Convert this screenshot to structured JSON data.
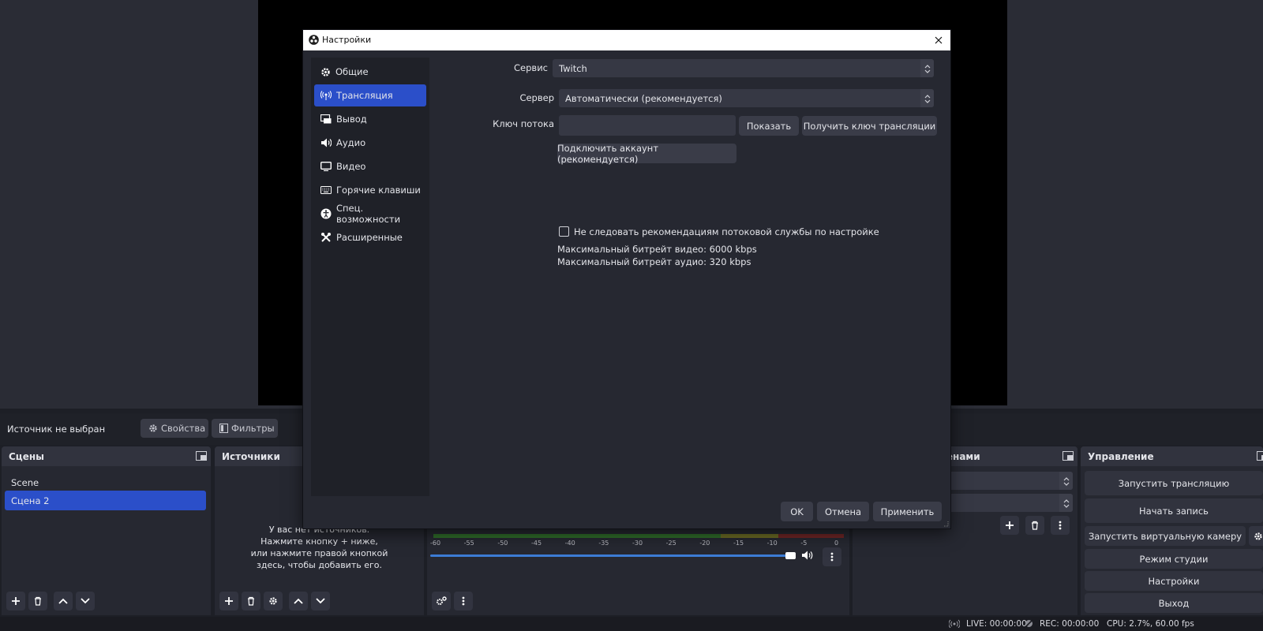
{
  "main": {
    "source_bar": {
      "no_source": "Источник не выбран",
      "properties": "Свойства",
      "filters": "Фильтры"
    },
    "scenes": {
      "title": "Сцены",
      "items": [
        "Scene",
        "Сцена 2"
      ],
      "selected": "Сцена 2"
    },
    "sources": {
      "title": "Источники",
      "empty_hint": [
        "У вас нет источников.",
        "Нажмите кнопку + ниже,",
        "или нажмите правой кнопкой",
        "здесь, чтобы добавить его."
      ]
    },
    "mixer": {
      "scale": [
        "-60",
        "-55",
        "-50",
        "-45",
        "-40",
        "-35",
        "-30",
        "-25",
        "-20",
        "-15",
        "-10",
        "-5",
        "0"
      ]
    },
    "transitions": {
      "title_fragment": "ценами"
    },
    "controls": {
      "title": "Управление",
      "buttons": [
        "Запустить трансляцию",
        "Начать запись",
        "Запустить виртуальную камеру",
        "Режим студии",
        "Настройки",
        "Выход"
      ]
    },
    "status": {
      "live": "LIVE: 00:00:00",
      "rec": "REC: 00:00:00",
      "cpu": "CPU: 2.7%, 60.00 fps"
    }
  },
  "dialog": {
    "title": "Настройки",
    "nav": [
      {
        "label": "Общие",
        "icon": "gear-icon"
      },
      {
        "label": "Трансляция",
        "icon": "broadcast-icon"
      },
      {
        "label": "Вывод",
        "icon": "output-icon"
      },
      {
        "label": "Аудио",
        "icon": "speaker-icon"
      },
      {
        "label": "Видео",
        "icon": "monitor-icon"
      },
      {
        "label": "Горячие клавиши",
        "icon": "keyboard-icon"
      },
      {
        "label": "Спец. возможности",
        "icon": "accessibility-icon"
      },
      {
        "label": "Расширенные",
        "icon": "tools-icon"
      }
    ],
    "selected_nav": "Трансляция",
    "stream": {
      "service_label": "Сервис",
      "service_value": "Twitch",
      "server_label": "Сервер",
      "server_value": "Автоматически (рекомендуется)",
      "key_label": "Ключ потока",
      "key_value": "",
      "show_button": "Показать",
      "get_key_button": "Получить ключ трансляции",
      "connect_button": "Подключить аккаунт (рекомендуется)",
      "ignore_checkbox": "Не следовать рекомендациям потоковой службы по настройке",
      "ignore_checked": false,
      "max_video": "Максимальный битрейт видео: 6000 kbps",
      "max_audio": "Максимальный битрейт аудио: 320 kbps"
    },
    "footer": {
      "ok": "OK",
      "cancel": "Отмена",
      "apply": "Применить"
    }
  },
  "colors": {
    "accent": "#2b4fc9",
    "background": "#1d1f26",
    "panel": "#262831"
  }
}
